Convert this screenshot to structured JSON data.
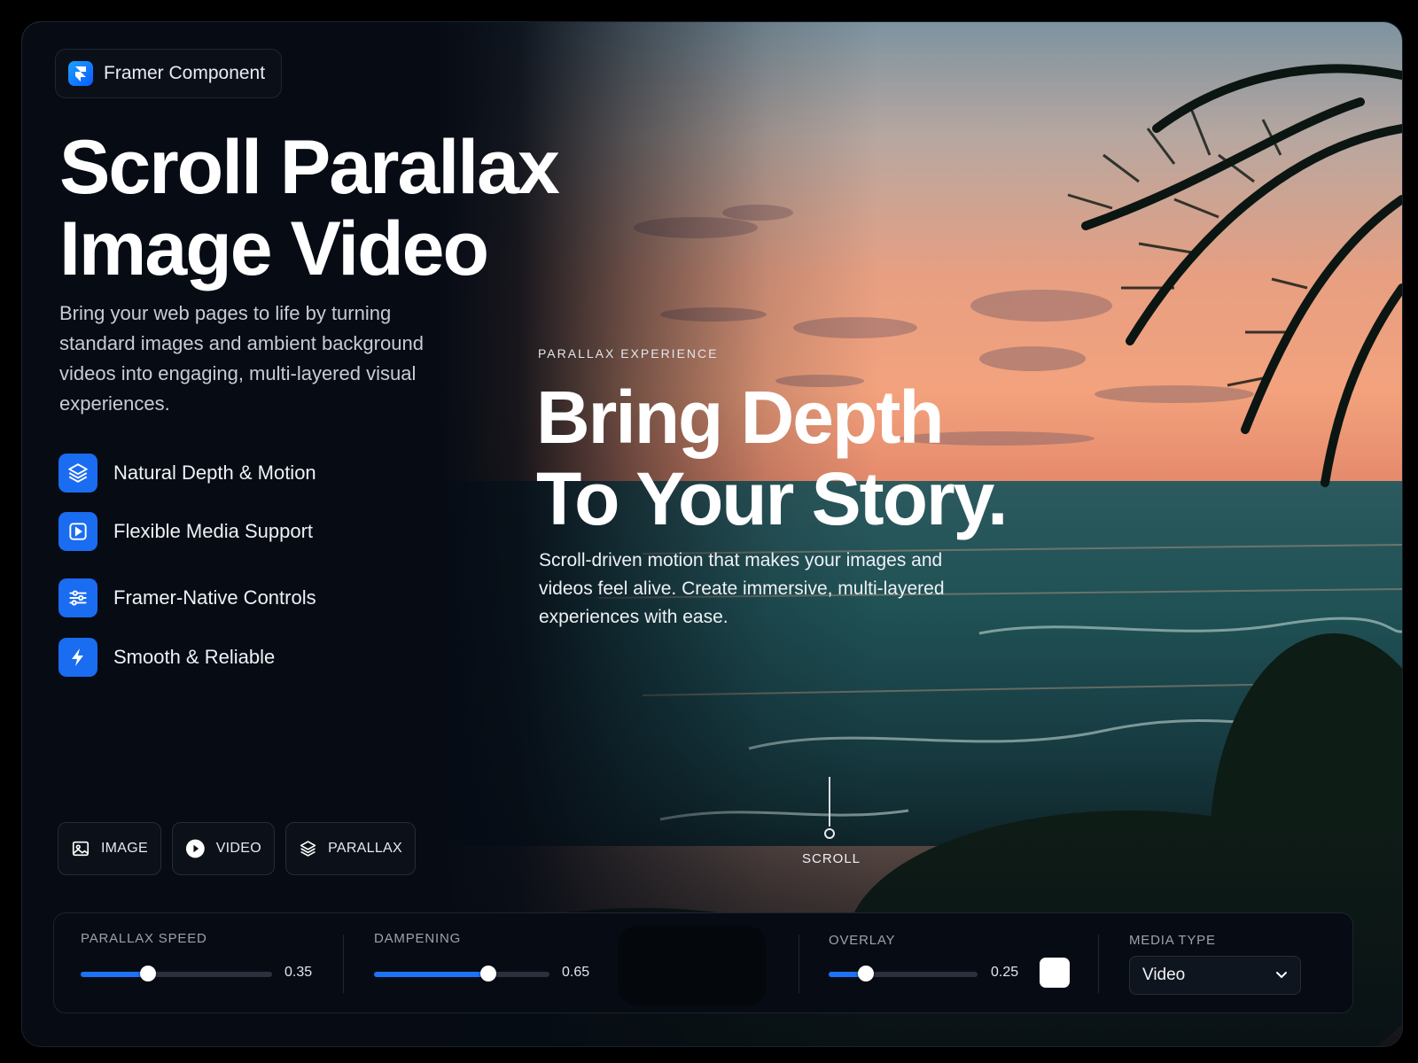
{
  "badge": {
    "label": "Framer Component",
    "icon": "framer-logo-icon"
  },
  "title": {
    "line1": "Scroll Parallax",
    "line2": "Image Video"
  },
  "intro": "Bring your web pages to life by turning standard images and ambient background videos into engaging, multi-layered visual experiences.",
  "features": [
    {
      "label": "Natural Depth & Motion",
      "icon": "layers-icon"
    },
    {
      "label": "Flexible Media Support",
      "icon": "play-square-icon"
    },
    {
      "label": "Framer-Native Controls",
      "icon": "sliders-icon"
    },
    {
      "label": "Smooth & Reliable",
      "icon": "lightning-icon"
    }
  ],
  "modes": [
    {
      "label": "IMAGE",
      "icon": "image-icon"
    },
    {
      "label": "VIDEO",
      "icon": "play-circle-icon"
    },
    {
      "label": "PARALLAX",
      "icon": "layers-icon"
    }
  ],
  "hero": {
    "eyebrow": "PARALLAX EXPERIENCE",
    "headline1": "Bring Depth",
    "headline2": "To Your Story.",
    "sub": "Scroll-driven motion that makes your images and videos feel alive. Create immersive, multi-layered experiences with ease.",
    "scroll_label": "SCROLL"
  },
  "controls": {
    "parallax_speed": {
      "label": "PARALLAX SPEED",
      "value": 0.35,
      "display": "0.35"
    },
    "dampening": {
      "label": "DAMPENING",
      "value": 0.65,
      "display": "0.65"
    },
    "overlay": {
      "label": "OVERLAY",
      "value": 0.25,
      "display": "0.25",
      "color": "#ffffff"
    },
    "media_type": {
      "label": "MEDIA TYPE",
      "selected": "Video"
    }
  },
  "colors": {
    "accent": "#1a6cf0",
    "background": "#060b14"
  }
}
